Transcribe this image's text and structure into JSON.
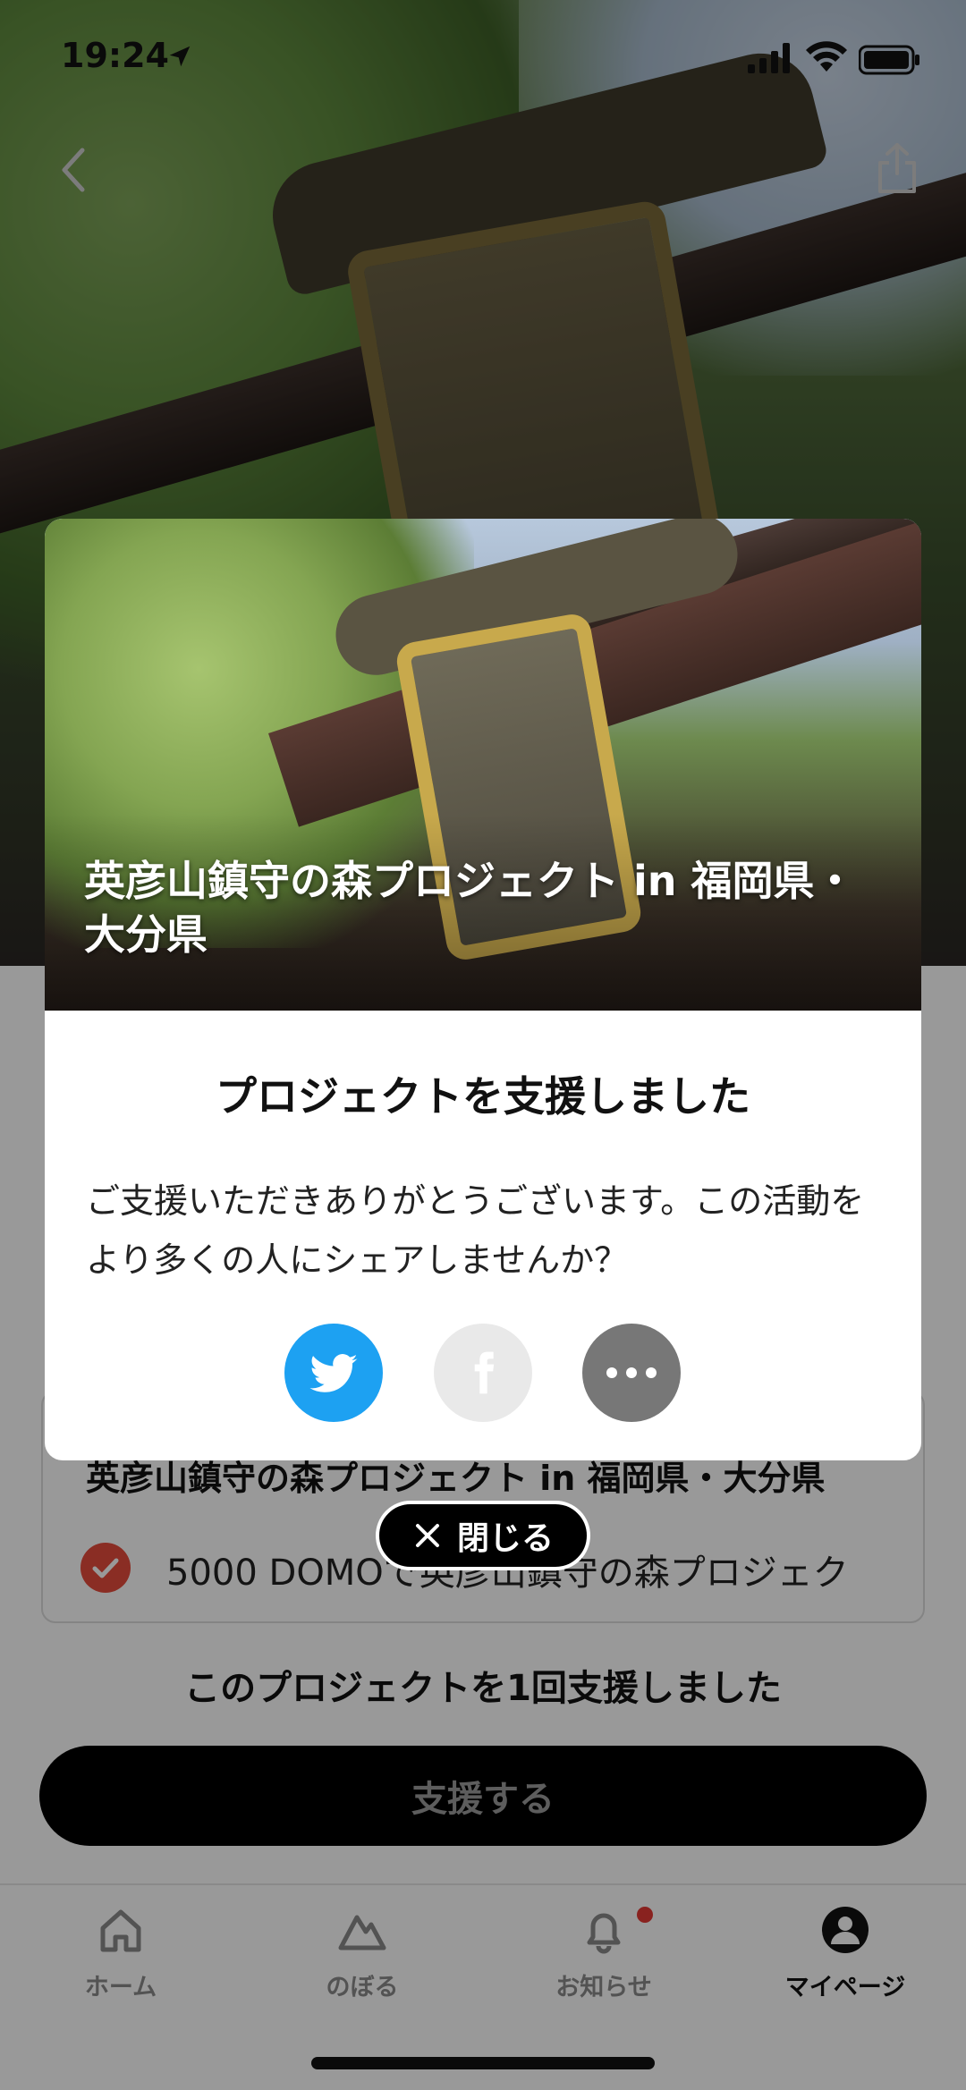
{
  "status_bar": {
    "time": "19:24"
  },
  "modal": {
    "image_title": "英彦山鎮守の森プロジェクト in 福岡県・大分県",
    "heading": "プロジェクトを支援しました",
    "message": "ご支援いただきありがとうございます。この活動をより多くの人にシェアしませんか？",
    "share_buttons": [
      {
        "icon": "twitter-icon",
        "color": "#1DA1F2"
      },
      {
        "icon": "facebook-icon",
        "color": "#E9E9E9"
      },
      {
        "icon": "more-icon",
        "color": "#777777"
      }
    ]
  },
  "close_button": {
    "label": "閉じる"
  },
  "background": {
    "reward_title": "英彦山鎮守の森プロジェクト in 福岡県・大分県",
    "reward_item": "5000 DOMOで英彦山鎮守の森プロジェク",
    "support_count": "このプロジェクトを1回支援しました",
    "support_button": "支援する"
  },
  "tab_bar": {
    "tabs": [
      {
        "label": "ホーム",
        "icon": "home-icon",
        "active": false
      },
      {
        "label": "のぼる",
        "icon": "mountain-icon",
        "active": false
      },
      {
        "label": "お知らせ",
        "icon": "bell-icon",
        "active": false,
        "badge": true
      },
      {
        "label": "マイページ",
        "icon": "user-icon",
        "active": true
      }
    ]
  },
  "colors": {
    "accent_red": "#E74C3C",
    "twitter_blue": "#1DA1F2"
  }
}
